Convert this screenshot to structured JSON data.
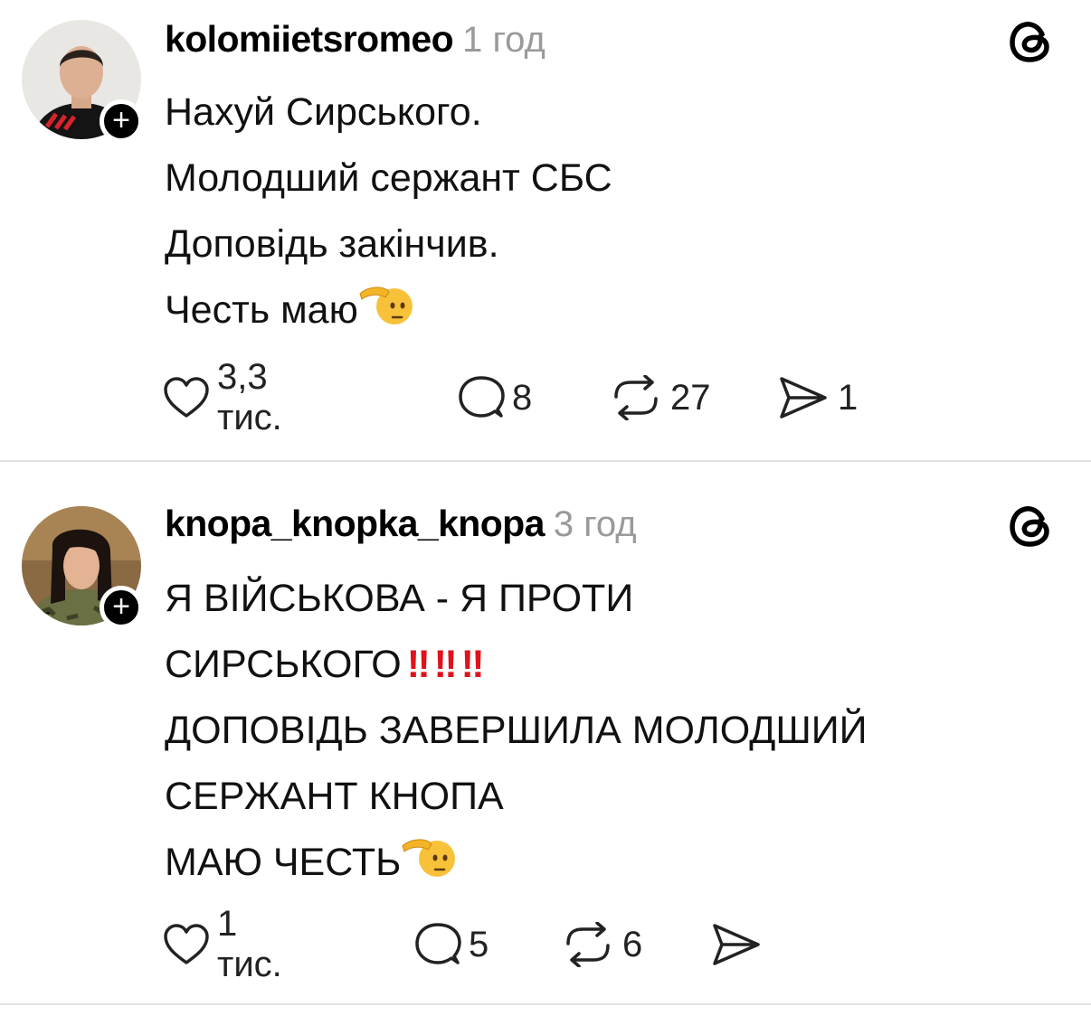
{
  "posts": [
    {
      "username": "kolomiietsromeo",
      "time": "1 год",
      "lines": [
        "Нахуй Сирського.",
        "Молодший сержант СБС",
        "Доповідь закінчив.",
        "Честь маю"
      ],
      "likes": "3,3 тис.",
      "comments": "8",
      "reposts": "27",
      "shares": "1",
      "follow_label": "+"
    },
    {
      "username": "knopa_knopka_knopa",
      "time": "3 год",
      "lines": [
        "Я ВІЙСЬКОВА - Я ПРОТИ",
        "СИРСЬКОГО",
        "ДОПОВІДЬ ЗАВЕРШИЛА МОЛОДШИЙ",
        "СЕРЖАНТ КНОПА",
        "МАЮ ЧЕСТЬ"
      ],
      "likes": "1 тис.",
      "comments": "5",
      "reposts": "6",
      "shares": "",
      "follow_label": "+"
    }
  ],
  "icons": {
    "salute": "saluting-face-emoji",
    "exclamation": "double-exclamation-emoji",
    "threads": "threads-logo-icon",
    "like": "heart-icon",
    "comment": "comment-bubble-icon",
    "repost": "repost-icon",
    "share": "send-icon"
  },
  "colors": {
    "exclamation": "#e0121b",
    "time": "#9a9a9a",
    "divider": "#e3e3e3"
  }
}
